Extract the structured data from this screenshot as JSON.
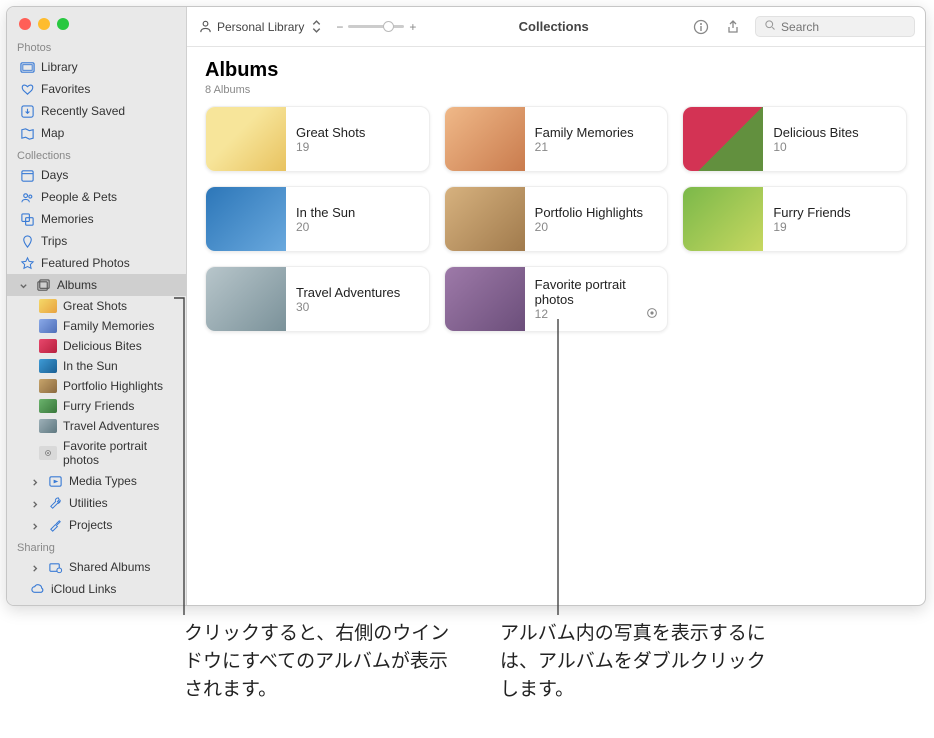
{
  "window": {
    "library_label": "Personal Library",
    "toolbar_center": "Collections",
    "search_placeholder": "Search"
  },
  "sidebar": {
    "sections": {
      "photos": "Photos",
      "collections": "Collections",
      "sharing": "Sharing"
    },
    "photos_items": [
      "Library",
      "Favorites",
      "Recently Saved",
      "Map"
    ],
    "collections_items": [
      "Days",
      "People & Pets",
      "Memories",
      "Trips",
      "Featured Photos",
      "Albums"
    ],
    "album_subitems": [
      "Great Shots",
      "Family Memories",
      "Delicious Bites",
      "In the Sun",
      "Portfolio Highlights",
      "Furry Friends",
      "Travel Adventures",
      "Favorite portrait photos"
    ],
    "collections_tail": [
      "Media Types",
      "Utilities",
      "Projects"
    ],
    "sharing_items": [
      "Shared Albums",
      "iCloud Links"
    ]
  },
  "page": {
    "title": "Albums",
    "subtitle": "8 Albums"
  },
  "albums": [
    {
      "name": "Great Shots",
      "count": "19"
    },
    {
      "name": "Family Memories",
      "count": "21"
    },
    {
      "name": "Delicious Bites",
      "count": "10"
    },
    {
      "name": "In the Sun",
      "count": "20"
    },
    {
      "name": "Portfolio Highlights",
      "count": "20"
    },
    {
      "name": "Furry Friends",
      "count": "19"
    },
    {
      "name": "Travel Adventures",
      "count": "30"
    },
    {
      "name": "Favorite portrait photos",
      "count": "12"
    }
  ],
  "callouts": {
    "left": "クリックすると、右側のウインドウにすべてのアルバムが表示されます。",
    "right": "アルバム内の写真を表示するには、アルバムをダブルクリックします。"
  }
}
